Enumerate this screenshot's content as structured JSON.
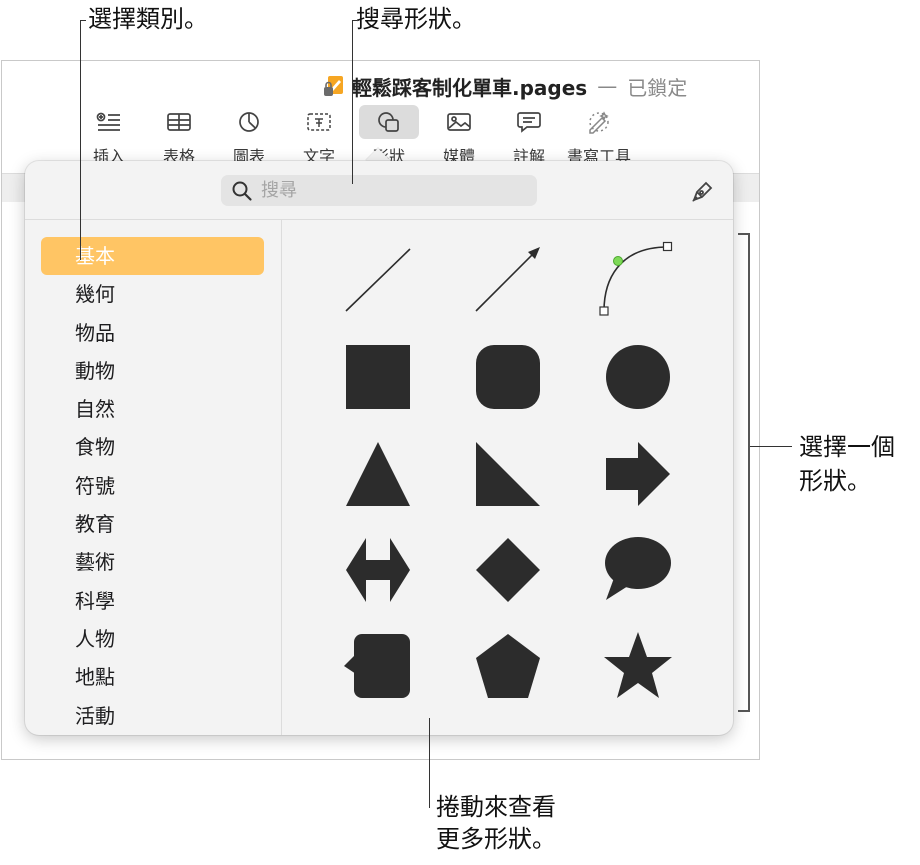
{
  "annotations": {
    "choose_category": "選擇類別。",
    "search_shapes": "搜尋形狀。",
    "choose_shape_line1": "選擇一個",
    "choose_shape_line2": "形狀。",
    "scroll_line1": "捲動來查看",
    "scroll_line2": "更多形狀。"
  },
  "window": {
    "doc_title": "輕鬆踩客制化單車.pages",
    "dash": "—",
    "status": "已鎖定"
  },
  "toolbar": {
    "items": [
      {
        "label": "插入",
        "icon": "insert-icon"
      },
      {
        "label": "表格",
        "icon": "table-icon"
      },
      {
        "label": "圖表",
        "icon": "chart-icon"
      },
      {
        "label": "文字",
        "icon": "text-icon"
      },
      {
        "label": "形狀",
        "icon": "shape-icon",
        "active": true
      },
      {
        "label": "媒體",
        "icon": "media-icon"
      },
      {
        "label": "註解",
        "icon": "comment-icon"
      },
      {
        "label": "書寫工具",
        "icon": "writing-tools-icon"
      }
    ]
  },
  "shape_library": {
    "search_placeholder": "搜尋",
    "categories": [
      "基本",
      "幾何",
      "物品",
      "動物",
      "自然",
      "食物",
      "符號",
      "教育",
      "藝術",
      "科學",
      "人物",
      "地點",
      "活動"
    ],
    "selected_category": "基本",
    "shapes": [
      "line",
      "arrow-line",
      "curve",
      "square",
      "rounded-square",
      "circle",
      "triangle",
      "right-triangle",
      "arrow-right",
      "double-arrow",
      "diamond",
      "speech-bubble",
      "callout-square",
      "pentagon",
      "star"
    ],
    "shape_fill": "#2c2c2c",
    "accent_point": "#7ed957"
  },
  "colors": {
    "selected_category_bg": "#ffc564",
    "popover_bg": "#f3f3f3"
  }
}
